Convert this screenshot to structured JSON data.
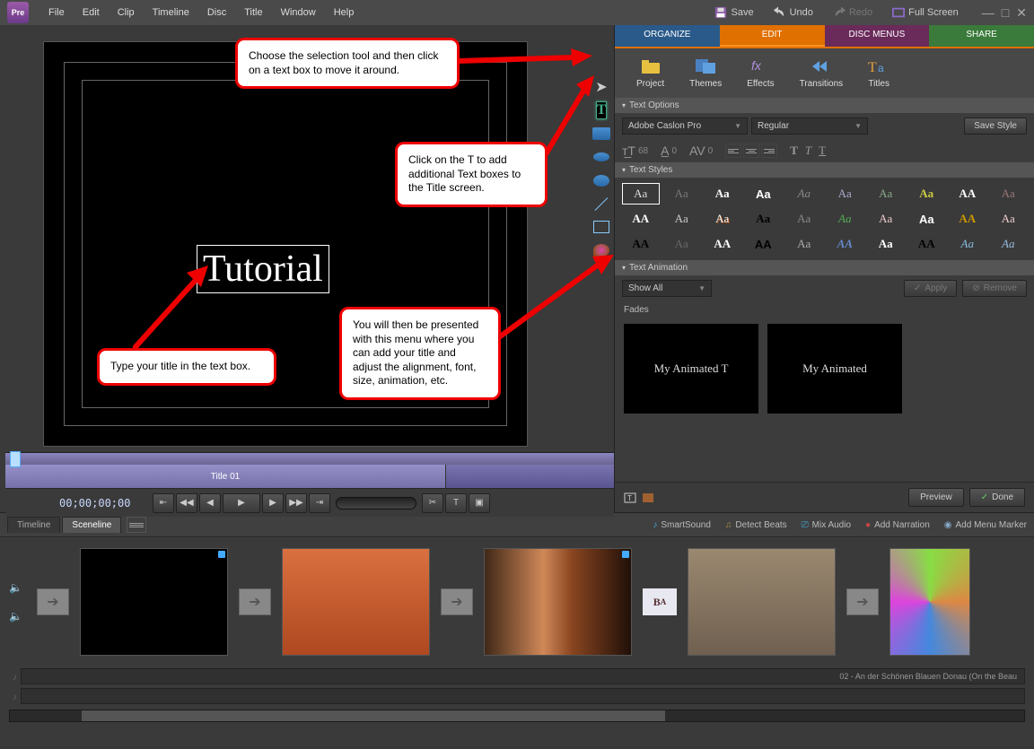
{
  "menu": {
    "items": [
      "File",
      "Edit",
      "Clip",
      "Timeline",
      "Disc",
      "Title",
      "Window",
      "Help"
    ],
    "save": "Save",
    "undo": "Undo",
    "redo": "Redo",
    "fullscreen": "Full Screen"
  },
  "callouts": {
    "sel": "Choose the selection tool and then click on a text box to move it around.",
    "t": "Click on the T to add additional Text boxes to the Title screen.",
    "type": "Type your title in the text box.",
    "menu": "You will then be presented with this menu where you can add your title and adjust the alignment, font, size, animation, etc."
  },
  "title_text": "Tutorial",
  "timeline": {
    "clip": "Title 01",
    "tc": "00;00;00;00"
  },
  "tabs": {
    "org": "ORGANIZE",
    "edit": "EDIT",
    "disc": "DISC MENUS",
    "share": "SHARE"
  },
  "toolbar": [
    {
      "l": "Project"
    },
    {
      "l": "Themes"
    },
    {
      "l": "Effects"
    },
    {
      "l": "Transitions"
    },
    {
      "l": "Titles"
    }
  ],
  "sections": {
    "opts": "Text Options",
    "styles": "Text Styles",
    "anim": "Text Animation"
  },
  "font": {
    "name": "Adobe Caslon Pro",
    "weight": "Regular",
    "savestyle": "Save Style",
    "size": "68",
    "kern": "0",
    "lead": "0"
  },
  "anim": {
    "filter": "Show All",
    "apply": "Apply",
    "remove": "Remove",
    "fades": "Fades",
    "pv1": "My Animated T",
    "pv2": "My Animated"
  },
  "btns": {
    "preview": "Preview",
    "done": "Done"
  },
  "sl": {
    "timeline": "Timeline",
    "sceneline": "Sceneline",
    "smart": "SmartSound",
    "detect": "Detect Beats",
    "mix": "Mix Audio",
    "narr": "Add Narration",
    "marker": "Add Menu Marker",
    "audio": "02 - An der Schönen Blauen Donau (On the Beau"
  }
}
